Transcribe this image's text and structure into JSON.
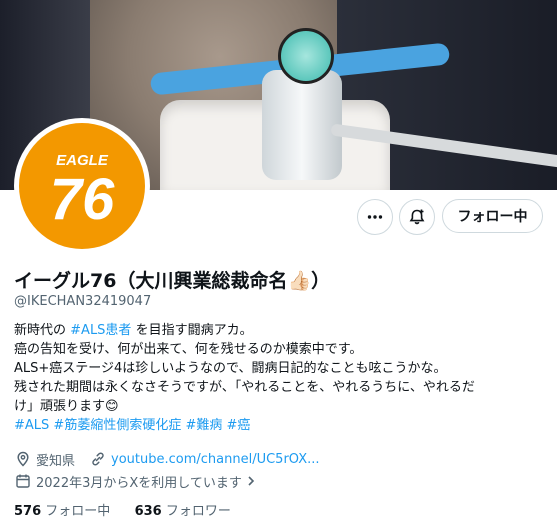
{
  "profile": {
    "avatar_text": "EAGLE 76",
    "display_name": "イーグル76（大川興業総裁命名👍🏻）",
    "handle": "@IKECHAN32419047",
    "bio": {
      "line1_pre": "新時代の",
      "line1_tag": "#ALS患者",
      "line1_post": "を目指す闘病アカ。",
      "line2": "癌の告知を受け、何が出来て、何を残せるのか模索中です。",
      "line3": "ALS+癌ステージ4は珍しいようなので、闘病日記的なことも呟こうかな。",
      "line4": "残された期間は永くなさそうですが、「やれることを、やれるうちに、やれるだ",
      "line5": "け」頑張ります😊",
      "hashtags": [
        "#ALS",
        "#筋萎縮性側索硬化症",
        "#難病",
        "#癌"
      ]
    },
    "location": "愛知県",
    "website": "youtube.com/channel/UC5rOX...",
    "joined": "2022年3月からXを利用しています",
    "following_count": "576",
    "following_label": "フォロー中",
    "followers_count": "636",
    "followers_label": "フォロワー"
  },
  "actions": {
    "follow_label": "フォロー中",
    "more_icon": "more-icon",
    "notify_icon": "notification-add-icon"
  },
  "colors": {
    "accent": "#1d9bf0",
    "avatar_orange": "#f39800",
    "muted": "#536471"
  }
}
